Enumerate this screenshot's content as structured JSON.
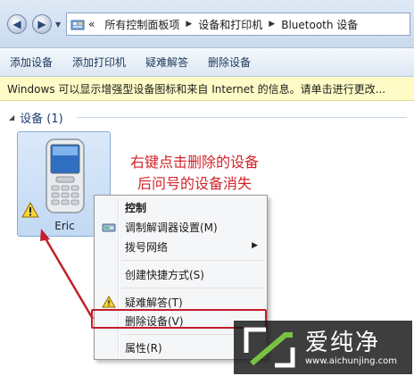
{
  "address_bar": {
    "overflow_chevron": "«",
    "breadcrumbs": [
      "所有控制面板项",
      "设备和打印机",
      "Bluetooth 设备"
    ],
    "back_icon": "back-arrow-icon",
    "forward_icon": "forward-arrow-icon"
  },
  "command_bar": {
    "items": [
      "添加设备",
      "添加打印机",
      "疑难解答",
      "删除设备"
    ]
  },
  "info_bar": {
    "text": "Windows 可以显示增强型设备图标和来自 Internet 的信息。请单击进行更改..."
  },
  "group": {
    "title": "设备 (1)"
  },
  "device": {
    "name": "Eric",
    "icon": "mobile-phone-icon",
    "status_icon": "warning-icon"
  },
  "annotation": {
    "line1": "右键点击删除的设备",
    "line2": "后问号的设备消失",
    "color": "#d2232a"
  },
  "context_menu": {
    "items": [
      {
        "label": "控制",
        "bold": true
      },
      {
        "label": "调制解调器设置(M)",
        "icon": "modem-icon"
      },
      {
        "label": "拨号网络",
        "submenu": true
      },
      {
        "label": "创建快捷方式(S)"
      },
      {
        "label": "疑难解答(T)",
        "icon": "warning-icon"
      },
      {
        "label": "删除设备(V)",
        "highlighted": true
      },
      {
        "label": "属性(R)"
      }
    ]
  },
  "watermark": {
    "title": "爱纯净",
    "url": "www.aichunjing.com"
  }
}
